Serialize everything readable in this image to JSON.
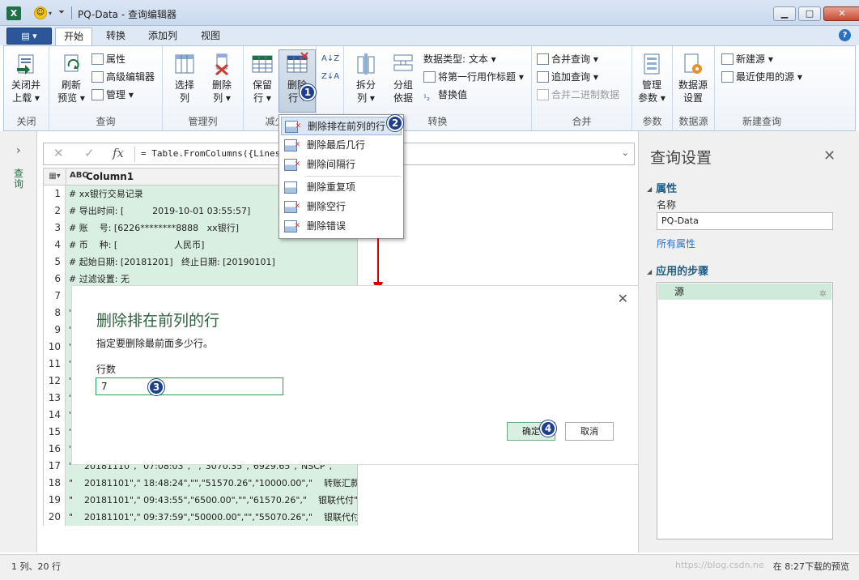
{
  "window": {
    "title": "PQ-Data - 查询编辑器",
    "logo": "X",
    "min": "▁",
    "max": "□",
    "close": "✕"
  },
  "tabs": {
    "file": "▤ ▾",
    "items": [
      "开始",
      "转换",
      "添加列",
      "视图"
    ],
    "help": "?"
  },
  "ribbon": {
    "groups": {
      "close": "关闭",
      "query": "查询",
      "manage_cols": "管理列",
      "reduce_rows": "减少行",
      "transform": "转换",
      "combine": "合并",
      "params": "参数",
      "datasource": "数据源",
      "new_query": "新建查询"
    },
    "close_load": [
      "关闭并",
      "上载 ▾"
    ],
    "refresh": [
      "刷新",
      "预览 ▾"
    ],
    "properties": "属性",
    "advanced_editor": "高级编辑器",
    "manage": "管理 ▾",
    "choose_cols": [
      "选择",
      "列"
    ],
    "remove_cols": [
      "删除",
      "列 ▾"
    ],
    "keep_rows": [
      "保留",
      "行 ▾"
    ],
    "remove_rows": [
      "删除",
      "行 ▾"
    ],
    "sort_az": "A↓Z",
    "sort_za": "Z↓A",
    "split": [
      "拆分",
      "列 ▾"
    ],
    "group_by": [
      "分组",
      "依据"
    ],
    "data_type": "数据类型: 文本 ▾",
    "first_row_header": "将第一行用作标题 ▾",
    "replace_values": "替换值",
    "merge_queries": "合并查询 ▾",
    "append_queries": "追加查询 ▾",
    "combine_binaries": "合并二进制数据",
    "manage_params": [
      "管理",
      "参数 ▾"
    ],
    "datasource_settings": [
      "数据源",
      "设置"
    ],
    "new_source": "新建源 ▾",
    "recent_sources": "最近使用的源 ▾"
  },
  "left_pane": {
    "collapse": "›",
    "label": "查询"
  },
  "formula": {
    "cancel": "✕",
    "commit": "✓",
    "fx": "fx",
    "text": "= Table.FromColumns({Lines                           ts",
    "expand": "⌄"
  },
  "grid": {
    "corner": "▦▾",
    "type_badge": "ABC",
    "column_header": "Column1",
    "rows": [
      {
        "n": "1",
        "v": "# xx银行交易记录"
      },
      {
        "n": "2",
        "v": "# 导出时间: [          2019-10-01 03:55:57]"
      },
      {
        "n": "3",
        "v": "# 账    号: [6226********8888   xx银行]"
      },
      {
        "n": "4",
        "v": "# 币    种: [                    人民币]"
      },
      {
        "n": "5",
        "v": "# 起始日期: [20181201]   终止日期: [20190101]"
      },
      {
        "n": "6",
        "v": "# 过滤设置: 无"
      },
      {
        "n": "7",
        "v": ""
      },
      {
        "n": "8",
        "v": "\""
      },
      {
        "n": "9",
        "v": "\""
      },
      {
        "n": "10",
        "v": "\""
      },
      {
        "n": "11",
        "v": "\""
      },
      {
        "n": "12",
        "v": "\""
      },
      {
        "n": "13",
        "v": "\""
      },
      {
        "n": "14",
        "v": "\""
      },
      {
        "n": "15",
        "v": "\""
      },
      {
        "n": "16",
        "v": "\""
      },
      {
        "n": "17",
        "v": "\"    20181110\",\" 07:08:03\",\"\",\"3070.35\",\"6929.65\",\"NSCP\",\"\""
      },
      {
        "n": "18",
        "v": "\"    20181101\",\" 18:48:24\",\"\",\"51570.26\",\"10000.00\",\"    转账汇款\",\"\""
      },
      {
        "n": "19",
        "v": "\"    20181101\",\" 09:43:55\",\"6500.00\",\"\",\"61570.26\",\"    银联代付\",\"\""
      },
      {
        "n": "20",
        "v": "\"    20181101\",\" 09:37:59\",\"50000.00\",\"\",\"55070.26\",\"    银联代付\",\"\""
      }
    ]
  },
  "query_settings": {
    "title": "查询设置",
    "close": "✕",
    "properties_section": "属性",
    "name_label": "名称",
    "name_value": "PQ-Data",
    "all_properties": "所有属性",
    "applied_steps_section": "应用的步骤",
    "steps": [
      "源"
    ],
    "step_gear": "✲"
  },
  "status": {
    "left": "1 列、20 行",
    "right": "在 8:27下载的预览",
    "watermark": "https://blog.csdn.ne"
  },
  "remove_rows_menu": {
    "items": [
      "删除排在前列的行",
      "删除最后几行",
      "删除间隔行",
      "删除重复项",
      "删除空行",
      "删除错误"
    ],
    "highlighted": 0
  },
  "dialog": {
    "title": "删除排在前列的行",
    "description": "指定要删除最前面多少行。",
    "rows_label": "行数",
    "rows_value": "7",
    "ok": "确定",
    "cancel": "取消",
    "close": "✕"
  },
  "badges": [
    "1",
    "2",
    "3",
    "4"
  ],
  "colors": {
    "accent_green": "#2d5f3f",
    "selected_green": "#d9efe1",
    "badge_blue": "#1e3f8c",
    "arrow_red": "#d40000"
  }
}
